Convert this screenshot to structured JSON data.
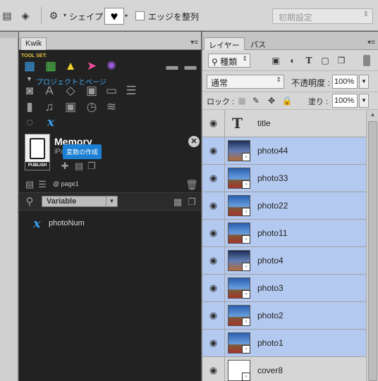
{
  "options_bar": {
    "shape_label": "シェイプ :",
    "edge_label": "エッジを整列",
    "preset_value": "初期設定"
  },
  "kwik": {
    "tab_label": "Kwik",
    "toolset_label": "TOOL SET:",
    "project_label": "プロジェクトとページ",
    "memory_title": "Memory",
    "device_sub": "iPad",
    "publish_label": "PUBLISH",
    "tooltip": "変数の作成",
    "page_label": "@ page1",
    "variable_select": "Variable",
    "variable_item": "photoNum"
  },
  "layers_panel": {
    "tab_layers": "レイヤー",
    "tab_paths": "パス",
    "kind_select": "種類",
    "blend_mode": "通常",
    "opacity_label": "不透明度 :",
    "opacity_value": "100%",
    "lock_label": "ロック :",
    "fill_label": "塗り :",
    "fill_value": "100%",
    "layers": [
      {
        "name": "title",
        "type": "text",
        "selected": false
      },
      {
        "name": "photo44",
        "type": "photo",
        "selected": true
      },
      {
        "name": "photo33",
        "type": "photo",
        "selected": true
      },
      {
        "name": "photo22",
        "type": "photo",
        "selected": true
      },
      {
        "name": "photo11",
        "type": "photo",
        "selected": true
      },
      {
        "name": "photo4",
        "type": "photo",
        "selected": true
      },
      {
        "name": "photo3",
        "type": "photo",
        "selected": true
      },
      {
        "name": "photo2",
        "type": "photo",
        "selected": true
      },
      {
        "name": "photo1",
        "type": "photo",
        "selected": true
      },
      {
        "name": "cover8",
        "type": "blank",
        "selected": false
      }
    ]
  },
  "icons": {
    "toolset": [
      "pages-icon",
      "grid-icon",
      "rocket-icon",
      "pointer-icon",
      "atom-icon"
    ],
    "colors": {
      "selection": "#b4c9f0",
      "kwik_blue": "#3aa0ee",
      "toolset_yellow": "#e6c440"
    }
  }
}
